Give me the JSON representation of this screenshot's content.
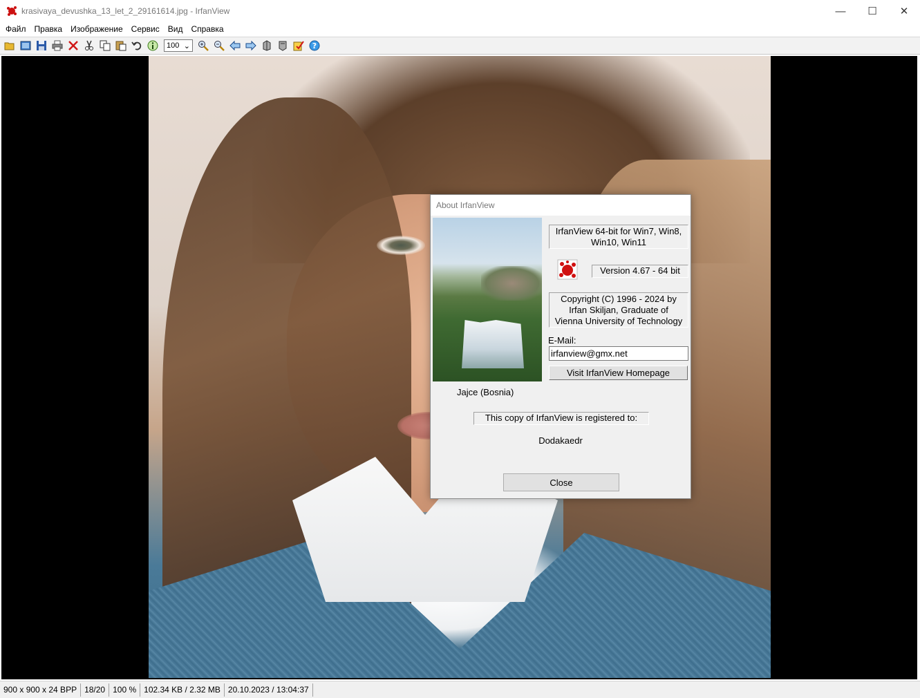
{
  "window": {
    "title": "krasivaya_devushka_13_let_2_29161614.jpg - IrfanView",
    "icon": "irfanview-logo-icon",
    "controls": {
      "minimize": "—",
      "maximize": "☐",
      "close": "✕"
    }
  },
  "menu": {
    "items": [
      "Файл",
      "Правка",
      "Изображение",
      "Сервис",
      "Вид",
      "Справка"
    ]
  },
  "toolbar": {
    "buttons": [
      "open-icon",
      "thumbnails-icon",
      "save-icon",
      "print-icon",
      "delete-icon",
      "cut-icon",
      "copy-icon",
      "paste-icon",
      "undo-icon",
      "info-icon"
    ],
    "zoom_value": "100",
    "buttons_after": [
      "zoom-in-icon",
      "zoom-out-icon",
      "previous-icon",
      "next-icon",
      "first-file-icon",
      "last-file-icon",
      "paint-icon",
      "help-icon"
    ]
  },
  "statusbar": {
    "dimensions": "900 x 900 x 24 BPP",
    "index": "18/20",
    "zoom": "100 %",
    "size": "102.34 KB / 2.32 MB",
    "datetime": "20.10.2023 / 13:04:37"
  },
  "about": {
    "title": "About  IrfanView",
    "product_line1": "IrfanView 64-bit for Win7, Win8,",
    "product_line2": "Win10, Win11",
    "version": "Version 4.67 - 64 bit",
    "copyright_line1": "Copyright (C) 1996 - 2024 by",
    "copyright_line2": "Irfan Skiljan, Graduate of",
    "copyright_line3": "Vienna University of Technology",
    "email_label": "E-Mail:",
    "email_value": "irfanview@gmx.net",
    "homepage_button": "Visit IrfanView Homepage",
    "photo_caption": "Jajce (Bosnia)",
    "registered_label": "This copy of IrfanView is registered to:",
    "registered_name": "Dodakaedr",
    "close_button": "Close"
  }
}
